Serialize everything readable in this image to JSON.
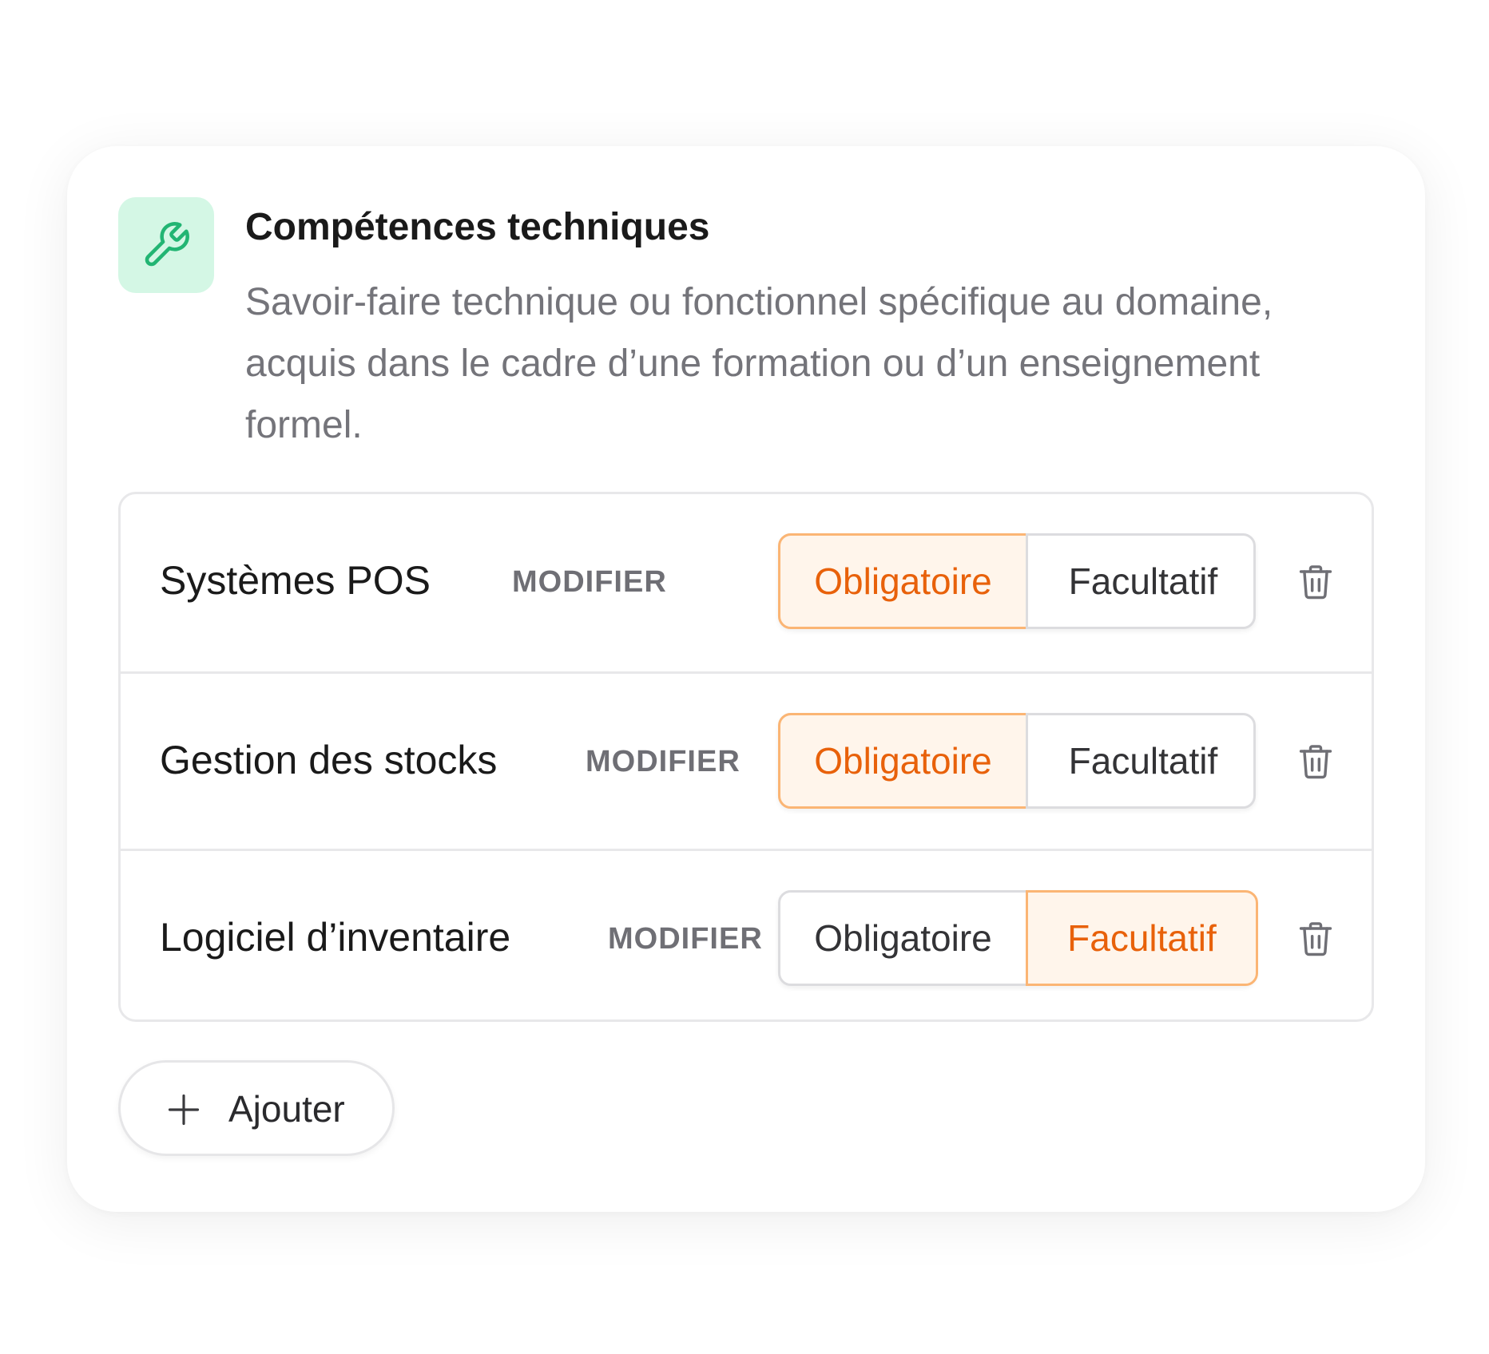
{
  "section": {
    "icon": "wrench-icon",
    "icon_tile_color": "#d4f7e5",
    "icon_color": "#22b573",
    "title": "Compétences techniques",
    "description": "Savoir-faire technique ou fonctionnel spécifique au domaine, acquis dans le cadre d’une formation ou d’un enseignement formel."
  },
  "skills": [
    {
      "name": "Systèmes POS",
      "modify_label": "MODIFIER",
      "options": [
        "Obligatoire",
        "Facultatif"
      ],
      "selected": "Obligatoire",
      "delete_icon": "trash-icon"
    },
    {
      "name": "Gestion des stocks",
      "modify_label": "MODIFIER",
      "options": [
        "Obligatoire",
        "Facultatif"
      ],
      "selected": "Obligatoire",
      "delete_icon": "trash-icon"
    },
    {
      "name": "Logiciel d’inventaire",
      "modify_label": "MODIFIER",
      "options": [
        "Obligatoire",
        "Facultatif"
      ],
      "selected": "Facultatif",
      "delete_icon": "trash-icon"
    }
  ],
  "add_button": {
    "icon": "plus-icon",
    "label": "Ajouter"
  },
  "colors": {
    "active_text": "#e8610a",
    "active_bg": "#fff5eb",
    "active_border": "#fbb574"
  }
}
